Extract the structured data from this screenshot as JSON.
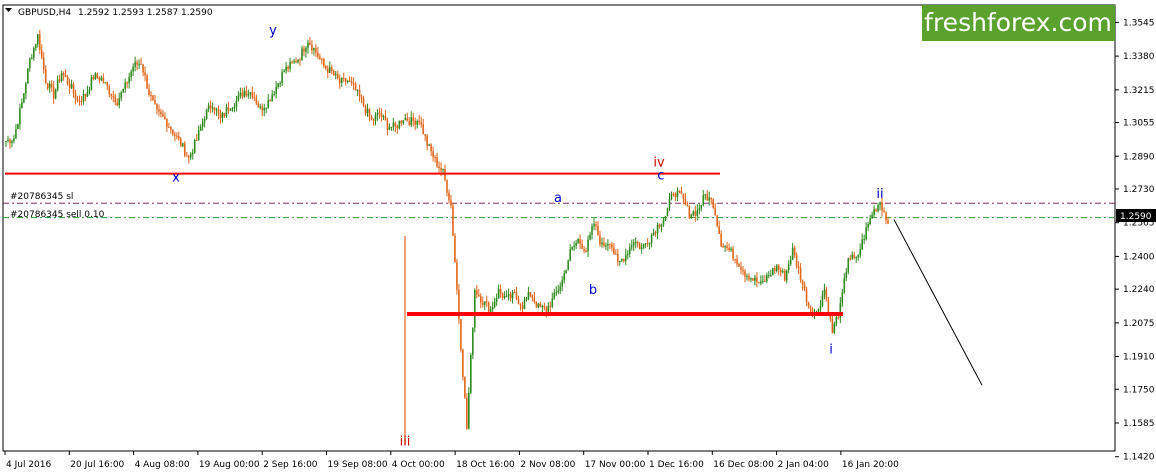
{
  "header": {
    "symbol": "GBPUSD,H4",
    "ohlc": "1.2592 1.2593 1.2587 1.2590"
  },
  "brand": {
    "text": "freshforex.com"
  },
  "orders": {
    "sl_label": "#20786345 sl",
    "sell_label": "#20786345 sell 0.10"
  },
  "price_badge": "1.2590",
  "chart_data": {
    "type": "candlestick",
    "title": "",
    "ylim": [
      1.1448,
      1.363
    ],
    "y_ticks": [
      "1.3545",
      "1.3380",
      "1.3215",
      "1.3055",
      "1.2890",
      "1.2730",
      "1.2565",
      "1.2400",
      "1.2240",
      "1.2075",
      "1.1910",
      "1.1750",
      "1.1585",
      "1.1420"
    ],
    "x_ticks": [
      "4 Jul 2016",
      "20 Jul 16:00",
      "4 Aug 08:00",
      "19 Aug 00:00",
      "2 Sep 16:00",
      "19 Sep 08:00",
      "4 Oct 00:00",
      "18 Oct 16:00",
      "2 Nov 08:00",
      "17 Nov 00:00",
      "1 Dec 16:00",
      "16 Dec 08:00",
      "2 Jan 04:00",
      "16 Jan 20:00"
    ],
    "grid": false,
    "colors": {
      "bull": "#2e8b1e",
      "bear": "#e0661a",
      "resistance": "#ff0000",
      "wave_red": "#cc0000",
      "wave_blue": "#0000cc",
      "sl_line": "#7a2f5e",
      "order_line": "#2a9a2a",
      "badge": "#000000",
      "brand_bg": "#5aa12e"
    },
    "series_close": [
      1.2965,
      1.298,
      1.315,
      1.336,
      1.348,
      1.326,
      1.319,
      1.33,
      1.324,
      1.316,
      1.319,
      1.328,
      1.327,
      1.321,
      1.316,
      1.323,
      1.333,
      1.335,
      1.32,
      1.31,
      1.307,
      1.301,
      1.295,
      1.288,
      1.297,
      1.309,
      1.315,
      1.307,
      1.313,
      1.316,
      1.321,
      1.32,
      1.312,
      1.316,
      1.323,
      1.331,
      1.334,
      1.338,
      1.346,
      1.34,
      1.333,
      1.33,
      1.325,
      1.326,
      1.321,
      1.314,
      1.306,
      1.31,
      1.304,
      1.303,
      1.308,
      1.306,
      1.307,
      1.295,
      1.287,
      1.281,
      1.265,
      1.21,
      1.156,
      1.224,
      1.218,
      1.214,
      1.223,
      1.219,
      1.221,
      1.216,
      1.222,
      1.215,
      1.214,
      1.22,
      1.228,
      1.242,
      1.248,
      1.243,
      1.256,
      1.245,
      1.248,
      1.236,
      1.241,
      1.248,
      1.244,
      1.249,
      1.255,
      1.26,
      1.272,
      1.269,
      1.261,
      1.262,
      1.27,
      1.266,
      1.247,
      1.243,
      1.238,
      1.232,
      1.229,
      1.226,
      1.231,
      1.235,
      1.23,
      1.243,
      1.23,
      1.216,
      1.212,
      1.224,
      1.203,
      1.215,
      1.24,
      1.238,
      1.25,
      1.261,
      1.267,
      1.256
    ],
    "projection": [
      1.259,
      1.177
    ],
    "resistance_upper": 1.2805,
    "support_lower": 1.2118,
    "sl_level": 1.266,
    "order_level": 1.259,
    "wave_labels": [
      {
        "text": "y",
        "color": "blue",
        "price": 1.351
      },
      {
        "text": "x",
        "color": "blue",
        "price": 1.279
      },
      {
        "text": "iii",
        "color": "red",
        "price": 1.15
      },
      {
        "text": "a",
        "color": "blue",
        "price": 1.269
      },
      {
        "text": "b",
        "color": "blue",
        "price": 1.224
      },
      {
        "text": "iv",
        "color": "red",
        "price": 1.2865
      },
      {
        "text": "c",
        "color": "blue",
        "price": 1.28
      },
      {
        "text": "i",
        "color": "blue",
        "price": 1.195
      },
      {
        "text": "ii",
        "color": "blue",
        "price": 1.271
      }
    ]
  }
}
